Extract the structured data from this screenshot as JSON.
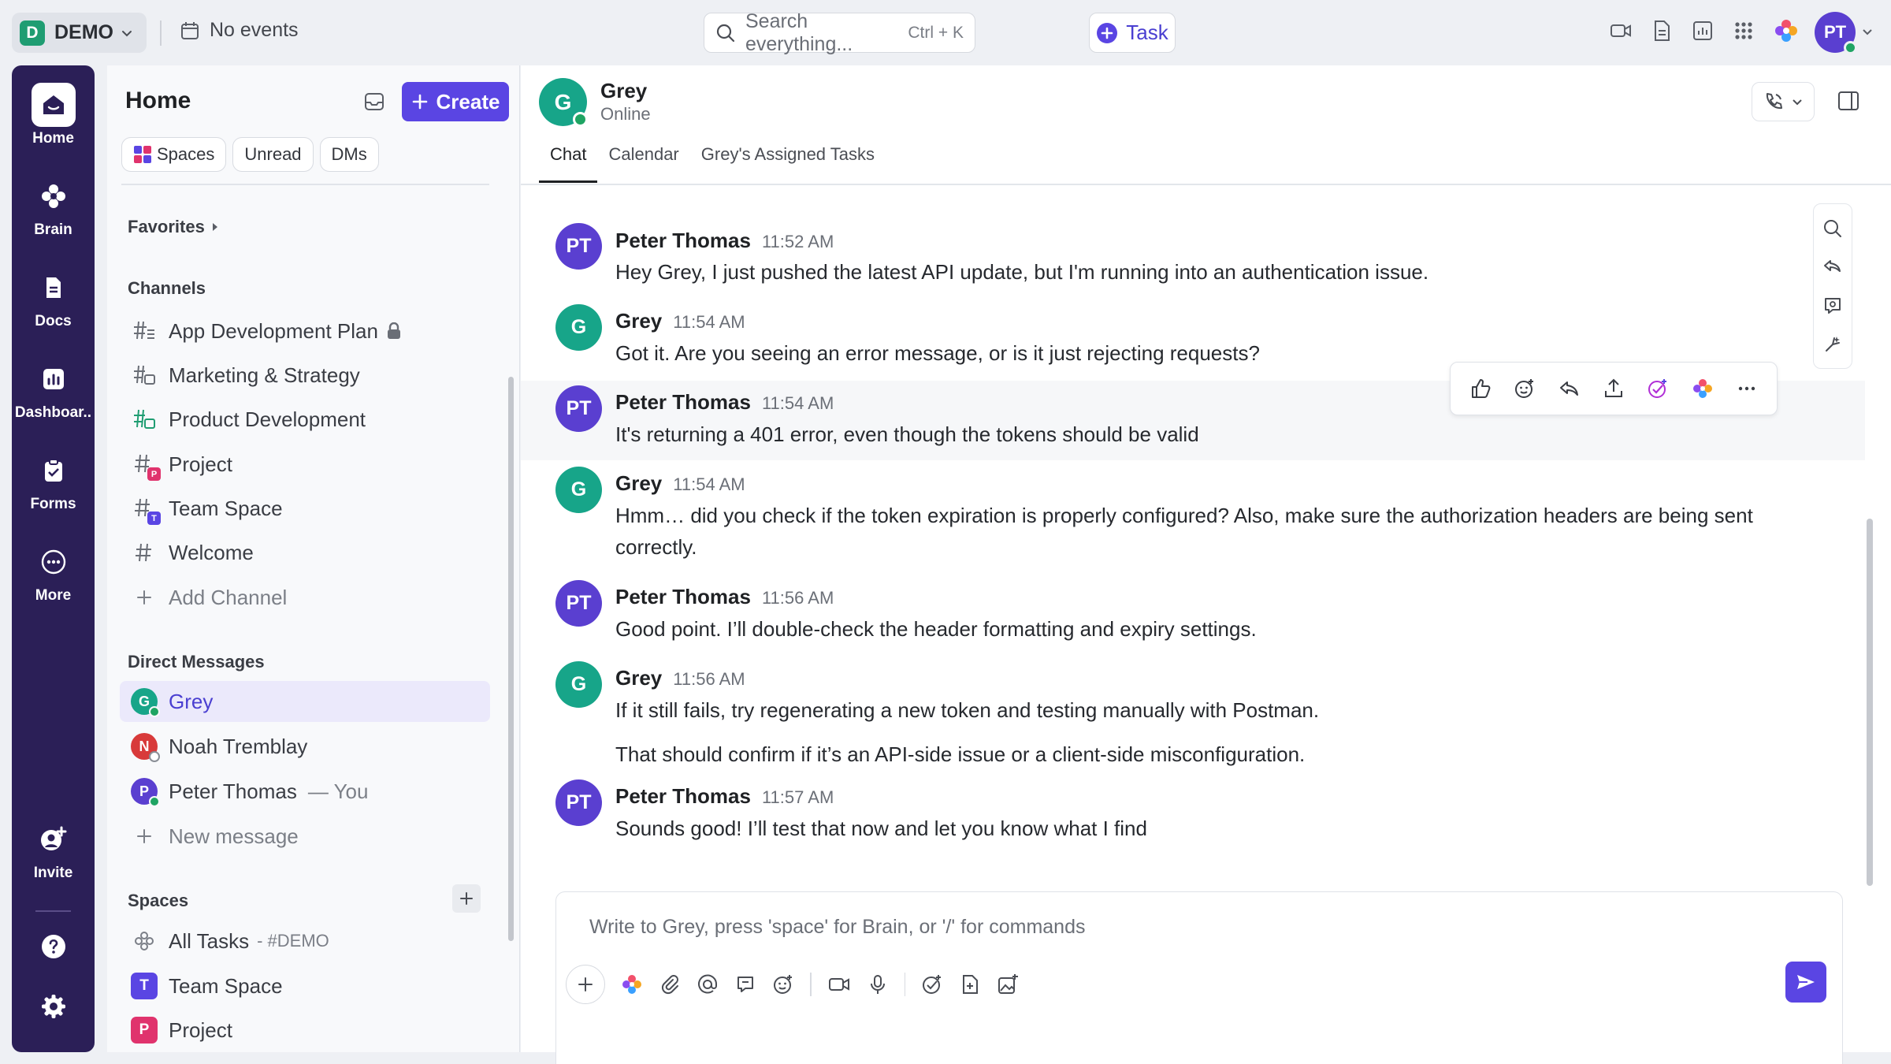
{
  "topbar": {
    "workspace_badge": "D",
    "workspace_name": "DEMO",
    "events_label": "No events",
    "search_placeholder": "Search everything...",
    "search_shortcut": "Ctrl + K",
    "task_label": "Task",
    "user_initials": "PT"
  },
  "rail": {
    "items": [
      {
        "label": "Home"
      },
      {
        "label": "Brain"
      },
      {
        "label": "Docs"
      },
      {
        "label": "Dashboar.."
      },
      {
        "label": "Forms"
      },
      {
        "label": "More"
      },
      {
        "label": "Invite"
      }
    ]
  },
  "sidebar": {
    "title": "Home",
    "create_label": "Create",
    "chips": [
      {
        "label": "Spaces"
      },
      {
        "label": "Unread"
      },
      {
        "label": "DMs"
      }
    ],
    "favorites_label": "Favorites",
    "channels_label": "Channels",
    "channels": [
      {
        "label": "App Development Plan"
      },
      {
        "label": "Marketing & Strategy"
      },
      {
        "label": "Product Development"
      },
      {
        "label": "Project",
        "badge": "P"
      },
      {
        "label": "Team Space",
        "badge": "T"
      },
      {
        "label": "Welcome"
      }
    ],
    "add_channel_label": "Add Channel",
    "dm_label": "Direct Messages",
    "dms": [
      {
        "label": "Grey",
        "initial": "G"
      },
      {
        "label": "Noah Tremblay",
        "initial": "N"
      },
      {
        "label": "Peter Thomas",
        "initial": "P",
        "suffix": "— You"
      }
    ],
    "new_message_label": "New message",
    "spaces_label": "Spaces",
    "spaces": [
      {
        "label": "All Tasks",
        "suffix": "- #DEMO"
      },
      {
        "label": "Team Space",
        "initial": "T"
      },
      {
        "label": "Project",
        "initial": "P"
      }
    ]
  },
  "chat": {
    "contact_initial": "G",
    "contact_name": "Grey",
    "contact_status": "Online",
    "tabs": [
      {
        "label": "Chat"
      },
      {
        "label": "Calendar"
      },
      {
        "label": "Grey's Assigned Tasks"
      }
    ],
    "messages": [
      {
        "initials": "PT",
        "author": "Peter Thomas",
        "time": "11:52 AM",
        "text": "Hey Grey, I just pushed the latest API update, but I'm running into an authentication issue."
      },
      {
        "initials": "G",
        "author": "Grey",
        "time": "11:54 AM",
        "text": "Got it. Are you seeing an error message, or is it just rejecting requests?"
      },
      {
        "initials": "PT",
        "author": "Peter Thomas",
        "time": "11:54 AM",
        "text": "It's returning a 401 error, even though the tokens should be valid"
      },
      {
        "initials": "G",
        "author": "Grey",
        "time": "11:54 AM",
        "text": "Hmm… did you check if the token expiration is properly configured? Also, make sure the authorization headers are being sent correctly."
      },
      {
        "initials": "PT",
        "author": "Peter Thomas",
        "time": "11:56 AM",
        "text": "Good point. I’ll double-check the header formatting and expiry settings."
      },
      {
        "initials": "G",
        "author": "Grey",
        "time": "11:56 AM",
        "text": "If it still fails, try regenerating a new token and testing manually with Postman.",
        "followup": "That should confirm if it’s an API-side issue or a client-side misconfiguration."
      },
      {
        "initials": "PT",
        "author": "Peter Thomas",
        "time": "11:57 AM",
        "text": "Sounds good! I’ll test that now and let you know what I find"
      }
    ],
    "composer_placeholder": "Write to Grey, press 'space' for Brain, or '/' for commands"
  },
  "colors": {
    "accent": "#5a45e3",
    "rail_bg": "#2b1f57",
    "grey_avatar": "#17a589",
    "peter_avatar": "#5a3fd0",
    "online": "#1fa463"
  }
}
